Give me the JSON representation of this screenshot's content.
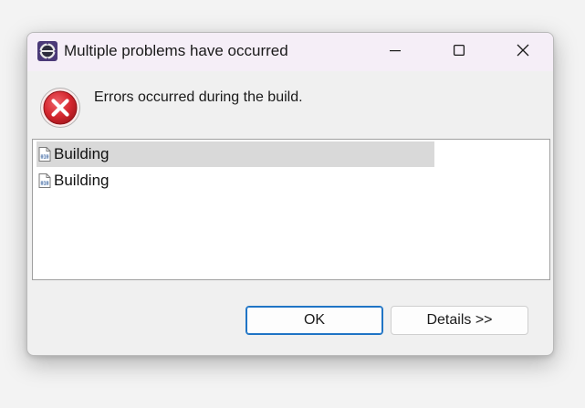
{
  "window": {
    "title": "Multiple problems have occurred",
    "app_icon": "eclipse-icon",
    "controls": [
      "minimize-icon",
      "maximize-icon",
      "close-icon"
    ]
  },
  "dialog": {
    "status_icon": "error-icon",
    "message": "Errors occurred during the build."
  },
  "problems": {
    "items": [
      {
        "label": "Building",
        "icon": "binary-file-icon",
        "selected": true
      },
      {
        "label": "Building",
        "icon": "binary-file-icon",
        "selected": false
      }
    ]
  },
  "buttons": {
    "ok_label": "OK",
    "details_label": "Details >>"
  },
  "colors": {
    "titlebar": "#f5eef7",
    "dialog_bg": "#f0f0f0",
    "error_red": "#c8282d",
    "selection": "#d9d9d9",
    "focus_border": "#1f74c5"
  }
}
